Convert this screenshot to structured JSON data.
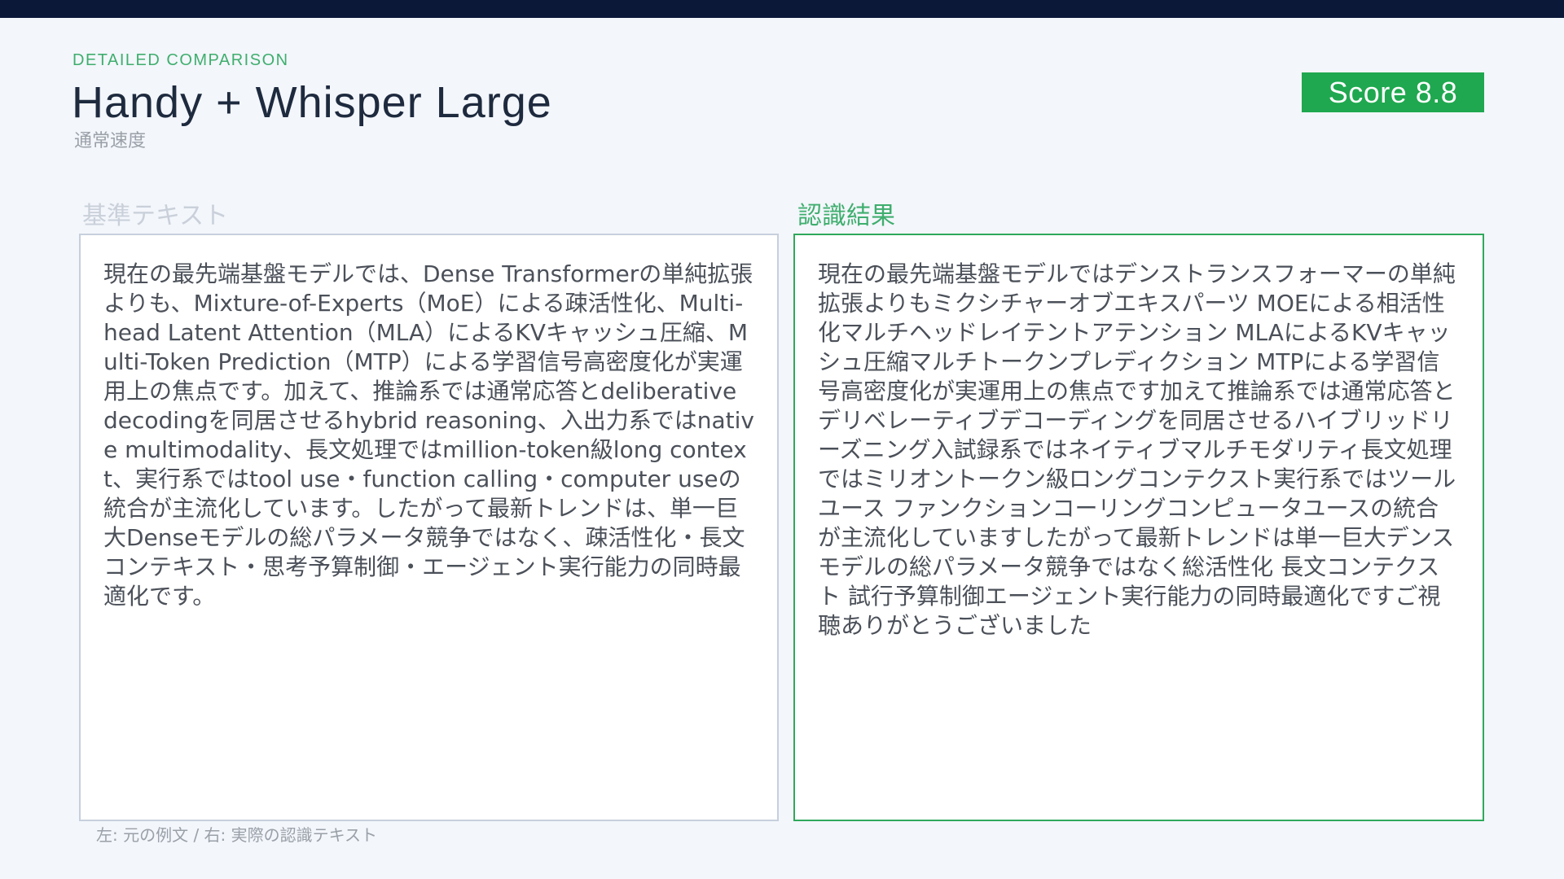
{
  "header": {
    "eyebrow": "DETAILED COMPARISON",
    "title": "Handy + Whisper Large",
    "subtitle": "通常速度",
    "score": "Score 8.8"
  },
  "columns": {
    "reference_label": "基準テキスト",
    "result_label": "認識結果",
    "reference_text": "現在の最先端基盤モデルでは、Dense Transformerの単純拡張よりも、Mixture-of-Experts（MoE）による疎活性化、Multi-head Latent Attention（MLA）によるKVキャッシュ圧縮、Multi-Token Prediction（MTP）による学習信号高密度化が実運用上の焦点です。加えて、推論系では通常応答とdeliberative decodingを同居させるhybrid reasoning、入出力系ではnative multimodality、長文処理ではmillion-token級long context、実行系ではtool use・function calling・computer useの統合が主流化しています。したがって最新トレンドは、単一巨大Denseモデルの総パラメータ競争ではなく、疎活性化・長文コンテキスト・思考予算制御・エージェント実行能力の同時最適化です。",
    "result_text": "現在の最先端基盤モデルではデンストランスフォーマーの単純拡張よりもミクシチャーオブエキスパーツ MOEによる相活性化マルチヘッドレイテントアテンション MLAによるKVキャッシュ圧縮マルチトークンプレディクション MTPによる学習信号高密度化が実運用上の焦点です加えて推論系では通常応答とデリベレーティブデコーディングを同居させるハイブリッドリーズニング入試録系ではネイティブマルチモダリティ長文処理ではミリオントークン級ロングコンテクスト実行系ではツールユース ファンクションコーリングコンピュータユースの統合が主流化していますしたがって最新トレンドは単一巨大デンスモデルの総パラメータ競争ではなく総活性化 長文コンテクスト 試行予算制御エージェント実行能力の同時最適化ですご視聴ありがとうございました"
  },
  "footer": {
    "note": "左: 元の例文 / 右: 実際の認識テキスト"
  },
  "colors": {
    "accent_green": "#1fa84f",
    "top_bar": "#0c1838",
    "background": "#f3f6fb"
  }
}
